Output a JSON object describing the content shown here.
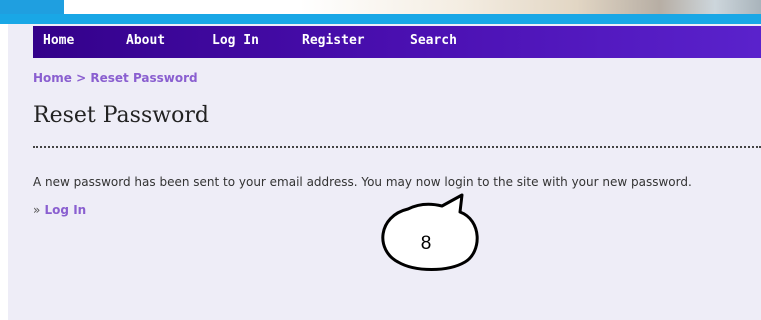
{
  "nav": {
    "items": [
      {
        "label": "Home"
      },
      {
        "label": "About"
      },
      {
        "label": "Log In"
      },
      {
        "label": "Register"
      },
      {
        "label": "Search"
      }
    ]
  },
  "breadcrumb": {
    "home": "Home",
    "separator": ">",
    "current": "Reset Password"
  },
  "page_title": "Reset Password",
  "message": "A new password has been sent to your email address. You may now login to the site with your new password.",
  "login_link": {
    "prefix": "»",
    "label": "Log In"
  },
  "callout": {
    "number": "8"
  },
  "colors": {
    "nav_bg": "#4a0fb0",
    "link": "#8a5fd0",
    "top_bar": "#19a7e6",
    "page_bg": "#eeedf7"
  }
}
